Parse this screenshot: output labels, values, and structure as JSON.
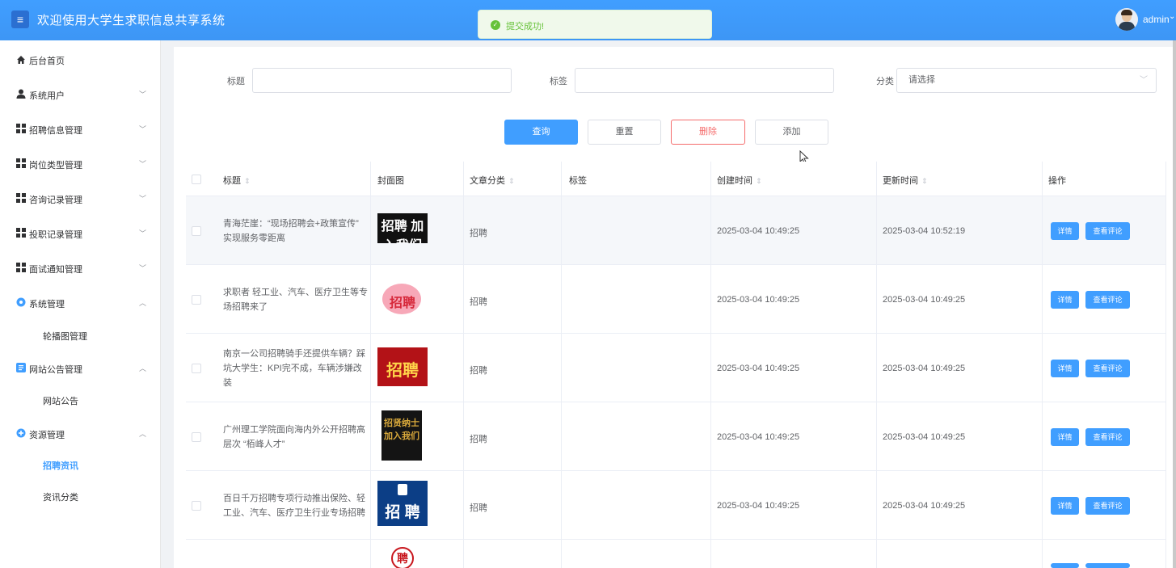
{
  "header": {
    "menu_icon": "menu-icon",
    "title": "欢迎使用大学生求职信息共享系统",
    "user": "admin",
    "colors": {
      "bar": "#409eff"
    }
  },
  "toast": {
    "text": "提交成功!",
    "icon": "check-circle-icon",
    "color": "#67c23a"
  },
  "sidebar": {
    "items": [
      {
        "label": "后台首页",
        "icon": "home-icon",
        "expandable": false
      },
      {
        "label": "系统用户",
        "icon": "user-icon",
        "expandable": true,
        "expanded": false
      },
      {
        "label": "招聘信息管理",
        "icon": "grid-icon",
        "expandable": true,
        "expanded": false
      },
      {
        "label": "岗位类型管理",
        "icon": "grid-icon",
        "expandable": true,
        "expanded": false
      },
      {
        "label": "咨询记录管理",
        "icon": "grid-icon",
        "expandable": true,
        "expanded": false
      },
      {
        "label": "投职记录管理",
        "icon": "grid-icon",
        "expandable": true,
        "expanded": false
      },
      {
        "label": "面试通知管理",
        "icon": "grid-icon",
        "expandable": true,
        "expanded": false
      },
      {
        "label": "系统管理",
        "icon": "settings-icon",
        "expandable": true,
        "expanded": true
      },
      {
        "label": "轮播图管理",
        "sub": true
      },
      {
        "label": "网站公告管理",
        "icon": "document-icon",
        "expandable": true,
        "expanded": true
      },
      {
        "label": "网站公告",
        "sub": true
      },
      {
        "label": "资源管理",
        "icon": "plus-circle-icon",
        "expandable": true,
        "expanded": true
      },
      {
        "label": "招聘资讯",
        "sub": true,
        "active": true
      },
      {
        "label": "资讯分类",
        "sub": true
      }
    ]
  },
  "search": {
    "title_label": "标题",
    "title_value": "",
    "tag_label": "标签",
    "tag_value": "",
    "category_label": "分类",
    "category_placeholder": "请选择"
  },
  "actions": {
    "query": "查询",
    "reset": "重置",
    "delete": "删除",
    "add": "添加"
  },
  "table": {
    "columns": [
      "标题",
      "封面图",
      "文章分类",
      "标签",
      "创建时间",
      "更新时间",
      "操作"
    ],
    "rows": [
      {
        "title": "青海茫崖：“现场招聘会+政策宣传” 实现服务零距离",
        "cover": "招聘 加入我们",
        "category": "招聘",
        "tag": "",
        "created": "2025-03-04 10:49:25",
        "updated": "2025-03-04 10:52:19"
      },
      {
        "title": "求职者 轻工业、汽车、医疗卫生等专场招聘来了",
        "cover": "招聘",
        "category": "招聘",
        "tag": "",
        "created": "2025-03-04 10:49:25",
        "updated": "2025-03-04 10:49:25"
      },
      {
        "title": "南京一公司招聘骑手还提供车辆？踩坑大学生：KPI完不成，车辆涉嫌改装",
        "cover": "招聘",
        "category": "招聘",
        "tag": "",
        "created": "2025-03-04 10:49:25",
        "updated": "2025-03-04 10:49:25"
      },
      {
        "title": "广州理工学院面向海内外公开招聘高层次 “栢峰人才”",
        "cover": "招贤纳士 加入我们",
        "category": "招聘",
        "tag": "",
        "created": "2025-03-04 10:49:25",
        "updated": "2025-03-04 10:49:25"
      },
      {
        "title": "百日千万招聘专项行动推出保险、轻工业、汽车、医疗卫生行业专场招聘",
        "cover": "招 聘",
        "category": "招聘",
        "tag": "",
        "created": "2025-03-04 10:49:25",
        "updated": "2025-03-04 10:49:25"
      }
    ],
    "partial_row_cover": "聘",
    "detail_label": "详情",
    "comments_label": "查看评论"
  }
}
